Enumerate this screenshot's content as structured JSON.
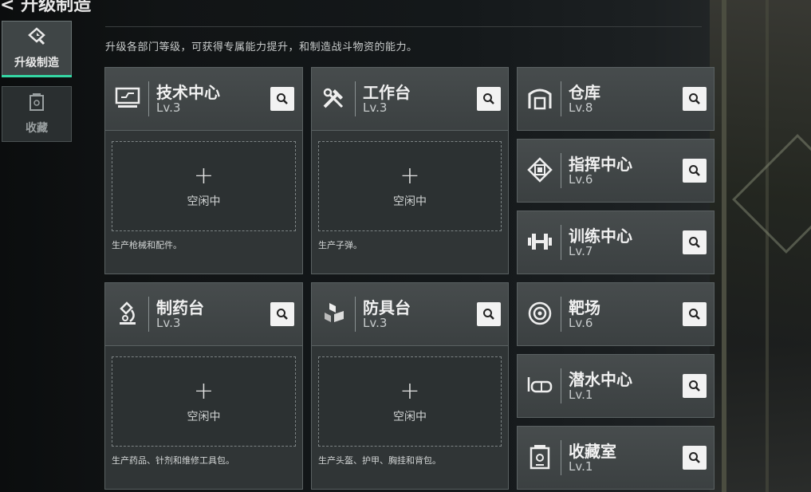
{
  "header": {
    "title": "< 升级制造",
    "description": "升级各部门等级，可获得专属能力提升，和制造战斗物资的能力。"
  },
  "sidebar": {
    "tabs": [
      {
        "label": "升级制造",
        "icon": "upgrade-hammer-icon",
        "active": true
      },
      {
        "label": "收藏",
        "icon": "collection-box-icon",
        "active": false
      }
    ]
  },
  "common": {
    "idle_label": "空闲中",
    "plus_glyph": "+"
  },
  "departments_large": [
    {
      "name": "技术中心",
      "level": "Lv.3",
      "icon": "tech-screen-icon",
      "footer": "生产枪械和配件。"
    },
    {
      "name": "工作台",
      "level": "Lv.3",
      "icon": "workbench-tools-icon",
      "footer": "生产子弹。"
    },
    {
      "name": "制药台",
      "level": "Lv.3",
      "icon": "microscope-icon",
      "footer": "生产药品、针剂和维修工具包。"
    },
    {
      "name": "防具台",
      "level": "Lv.3",
      "icon": "armor-blocks-icon",
      "footer": "生产头盔、护甲、胸挂和背包。"
    }
  ],
  "departments_small": [
    {
      "name": "仓库",
      "level": "Lv.8",
      "icon": "warehouse-icon"
    },
    {
      "name": "指挥中心",
      "level": "Lv.6",
      "icon": "command-chip-icon"
    },
    {
      "name": "训练中心",
      "level": "Lv.7",
      "icon": "dumbbell-icon"
    },
    {
      "name": "靶场",
      "level": "Lv.6",
      "icon": "target-icon"
    },
    {
      "name": "潜水中心",
      "level": "Lv.1",
      "icon": "diving-mask-icon"
    },
    {
      "name": "收藏室",
      "level": "Lv.1",
      "icon": "collection-room-icon"
    }
  ],
  "colors": {
    "accent": "#35d7a4",
    "card_bg": "#3a3f40",
    "search_button": "#f2f2f2"
  }
}
